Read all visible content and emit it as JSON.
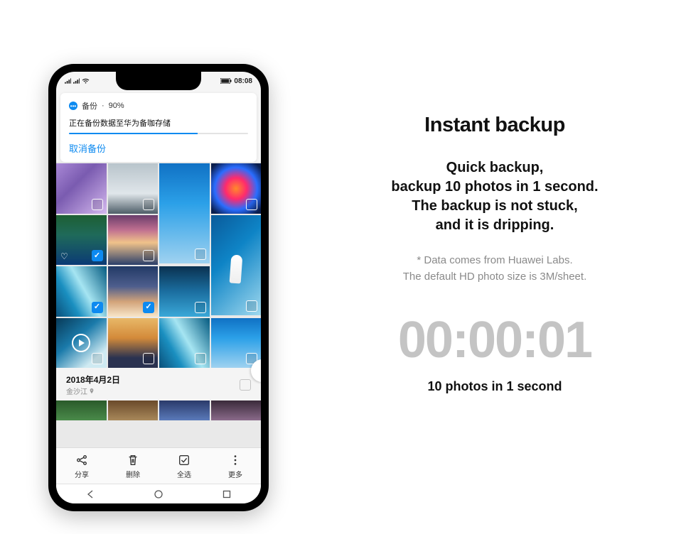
{
  "statusbar": {
    "time": "08:08"
  },
  "notif": {
    "title": "备份",
    "pct": "90%",
    "msg": "正在备份数据至华为备咖存储",
    "cancel": "取消备份"
  },
  "datebar": {
    "date": "2018年4月2日",
    "loc": "金沙江"
  },
  "toolbar": {
    "share": "分享",
    "delete": "删除",
    "select_all": "全选",
    "more": "更多"
  },
  "copy": {
    "headline": "Instant backup",
    "l1": "Quick backup,",
    "l2": "backup 10 photos in 1 second.",
    "l3": "The backup is not stuck,",
    "l4": "and it is dripping.",
    "disc1": "* Data comes from Huawei Labs.",
    "disc2": "The default HD photo size is 3M/sheet.",
    "timer": "00:00:01",
    "caption": "10 photos in 1 second"
  }
}
